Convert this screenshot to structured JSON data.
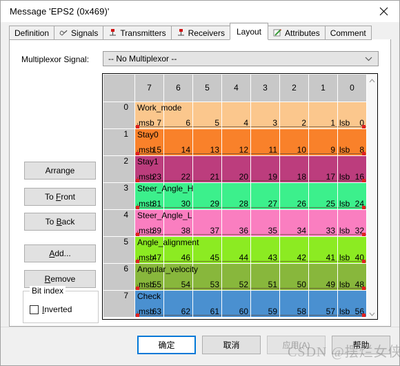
{
  "window": {
    "title": "Message 'EPS2 (0x469)'",
    "close_icon": "close-icon"
  },
  "tabs": [
    {
      "label": "Definition",
      "icon": "",
      "active": false
    },
    {
      "label": "Signals",
      "icon": "signal-wave-icon",
      "active": false
    },
    {
      "label": "Transmitters",
      "icon": "transmitter-icon",
      "active": false
    },
    {
      "label": "Receivers",
      "icon": "receiver-icon",
      "active": false
    },
    {
      "label": "Layout",
      "icon": "",
      "active": true
    },
    {
      "label": "Attributes",
      "icon": "pencil-icon",
      "active": false
    },
    {
      "label": "Comment",
      "icon": "",
      "active": false
    }
  ],
  "multiplexor": {
    "label": "Multiplexor Signal:",
    "value": "-- No Multiplexor --",
    "arrow_icon": "chevron-down-icon"
  },
  "buttons": {
    "arrange": {
      "pre": "Arran",
      "accel": "g",
      "post": "e"
    },
    "to_front": {
      "pre": "To ",
      "accel": "F",
      "post": "ront"
    },
    "to_back": {
      "pre": "To ",
      "accel": "B",
      "post": "ack"
    },
    "add": {
      "pre": "",
      "accel": "A",
      "post": "dd..."
    },
    "remove": {
      "pre": "",
      "accel": "R",
      "post": "emove"
    }
  },
  "bit_index_group": {
    "title": "Bit index",
    "checkbox": {
      "pre": "",
      "accel": "I",
      "post": "nverted",
      "checked": false
    }
  },
  "grid": {
    "column_headers": [
      "",
      "7",
      "6",
      "5",
      "4",
      "3",
      "2",
      "1",
      "0"
    ],
    "msb_label": "msb",
    "lsb_label": "lsb",
    "rows": [
      {
        "row": "0",
        "name": "Work_mode",
        "color": "#fbc78d",
        "bits": [
          "7",
          "6",
          "5",
          "4",
          "3",
          "2",
          "1",
          "0"
        ]
      },
      {
        "row": "1",
        "name": "Stay0",
        "color": "#f9812a",
        "bits": [
          "15",
          "14",
          "13",
          "12",
          "11",
          "10",
          "9",
          "8"
        ]
      },
      {
        "row": "2",
        "name": "Stay1",
        "color": "#bc3d7d",
        "bits": [
          "23",
          "22",
          "21",
          "20",
          "19",
          "18",
          "17",
          "16"
        ]
      },
      {
        "row": "3",
        "name": "Steer_Angle_H",
        "color": "#3cf08c",
        "bits": [
          "31",
          "30",
          "29",
          "28",
          "27",
          "26",
          "25",
          "24"
        ]
      },
      {
        "row": "4",
        "name": "Steer_Angle_L",
        "color": "#fa7ec0",
        "bits": [
          "39",
          "38",
          "37",
          "36",
          "35",
          "34",
          "33",
          "32"
        ]
      },
      {
        "row": "5",
        "name": "Angle_alignment",
        "color": "#8ceb22",
        "bits": [
          "47",
          "46",
          "45",
          "44",
          "43",
          "42",
          "41",
          "40"
        ]
      },
      {
        "row": "6",
        "name": "Angular_velocity",
        "color": "#88b73c",
        "bits": [
          "55",
          "54",
          "53",
          "52",
          "51",
          "50",
          "49",
          "48"
        ]
      },
      {
        "row": "7",
        "name": "Check",
        "color": "#4a90d0",
        "bits": [
          "63",
          "62",
          "61",
          "60",
          "59",
          "58",
          "57",
          "56"
        ]
      }
    ],
    "scroll_up_icon": "chevron-up-icon",
    "scroll_down_icon": "chevron-down-icon"
  },
  "footer": {
    "ok": "确定",
    "cancel": "取消",
    "apply": "应用(A)",
    "help": "帮助"
  },
  "watermark": "CSDN @摆烂女侠"
}
